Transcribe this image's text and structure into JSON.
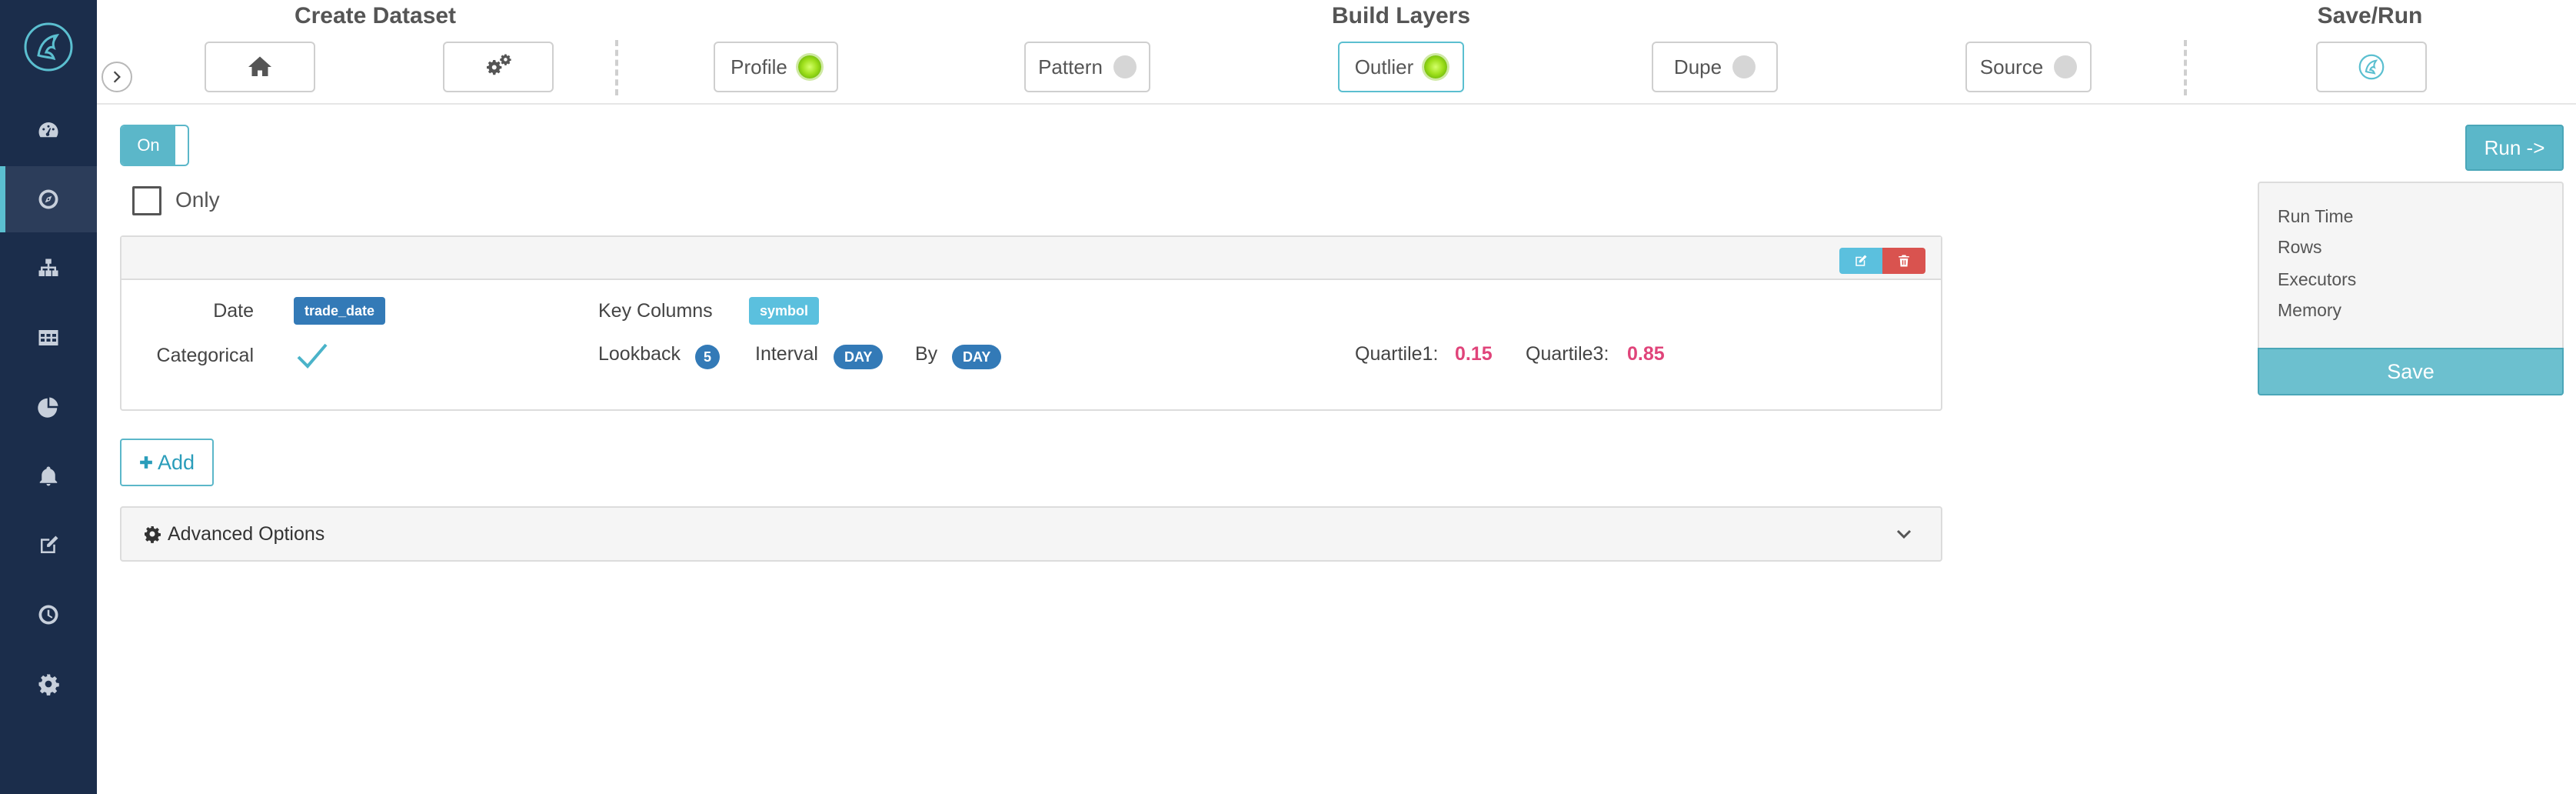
{
  "header": {
    "sections": {
      "create_dataset": "Create Dataset",
      "build_layers": "Build Layers",
      "save_run": "Save/Run"
    },
    "layers": [
      {
        "label": "Profile",
        "status": "active"
      },
      {
        "label": "Pattern",
        "status": "inactive"
      },
      {
        "label": "Outlier",
        "status": "active"
      },
      {
        "label": "Dupe",
        "status": "inactive"
      },
      {
        "label": "Source",
        "status": "inactive"
      }
    ],
    "icons": [
      "home-icon",
      "gears-icon",
      "bird-logo-icon"
    ]
  },
  "sidebar": {
    "items": [
      {
        "icon": "dashboard-icon"
      },
      {
        "icon": "compass-icon",
        "active": true
      },
      {
        "icon": "sitemap-icon"
      },
      {
        "icon": "table-icon"
      },
      {
        "icon": "pie-chart-icon"
      },
      {
        "icon": "bell-icon"
      },
      {
        "icon": "edit-icon"
      },
      {
        "icon": "clock-icon"
      },
      {
        "icon": "gear-icon"
      }
    ]
  },
  "controls": {
    "toggle_label": "On",
    "only_label": "Only"
  },
  "outlier": {
    "date_label": "Date",
    "date_value": "trade_date",
    "categorical_label": "Categorical",
    "key_columns_label": "Key Columns",
    "key_columns_value": "symbol",
    "lookback_label": "Lookback",
    "lookback_value": "5",
    "interval_label": "Interval",
    "interval_value": "DAY",
    "by_label": "By",
    "by_value": "DAY",
    "quartile1_label": "Quartile1:",
    "quartile1_value": "0.15",
    "quartile3_label": "Quartile3:",
    "quartile3_value": "0.85"
  },
  "actions": {
    "add_label": "Add",
    "advanced_label": "Advanced Options",
    "run_label": "Run ->",
    "save_label": "Save"
  },
  "stats": {
    "run_time": "Run Time",
    "rows": "Rows",
    "executors": "Executors",
    "memory": "Memory"
  },
  "colors": {
    "sidebar_bg": "#1b2d4b",
    "accent": "#5bb7c9",
    "badge_blue": "#337ab7",
    "danger": "#d9534f",
    "value_pink": "#e0447a",
    "status_green": "#9fe01c"
  }
}
